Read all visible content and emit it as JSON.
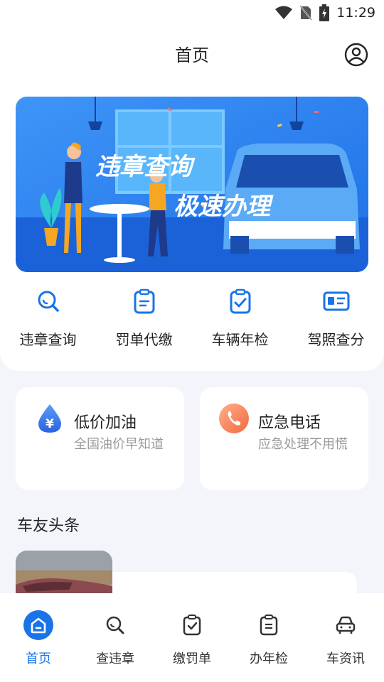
{
  "status": {
    "time": "11:29"
  },
  "header": {
    "title": "首页"
  },
  "banner": {
    "line1": "违章查询",
    "line2": "极速办理"
  },
  "quick_actions": [
    {
      "label": "违章查询",
      "icon": "search-icon"
    },
    {
      "label": "罚单代缴",
      "icon": "clipboard-list-icon"
    },
    {
      "label": "车辆年检",
      "icon": "clipboard-check-icon"
    },
    {
      "label": "驾照查分",
      "icon": "id-card-icon"
    }
  ],
  "services": [
    {
      "title": "低价加油",
      "desc": "全国油价早知道",
      "icon": "oil-drop-icon"
    },
    {
      "title": "应急电话",
      "desc": "应急处理不用慌",
      "icon": "phone-icon"
    }
  ],
  "news": {
    "section_title": "车友头条"
  },
  "bottom_nav": [
    {
      "label": "首页",
      "icon": "home-icon",
      "active": true
    },
    {
      "label": "查违章",
      "icon": "search-icon"
    },
    {
      "label": "缴罚单",
      "icon": "clipboard-check-icon"
    },
    {
      "label": "办年检",
      "icon": "clipboard-list-icon"
    },
    {
      "label": "车资讯",
      "icon": "car-icon"
    }
  ],
  "colors": {
    "accent": "#1a73e8",
    "banner_bg": "#2a7ff0",
    "page_bg": "#f3f5fb"
  }
}
